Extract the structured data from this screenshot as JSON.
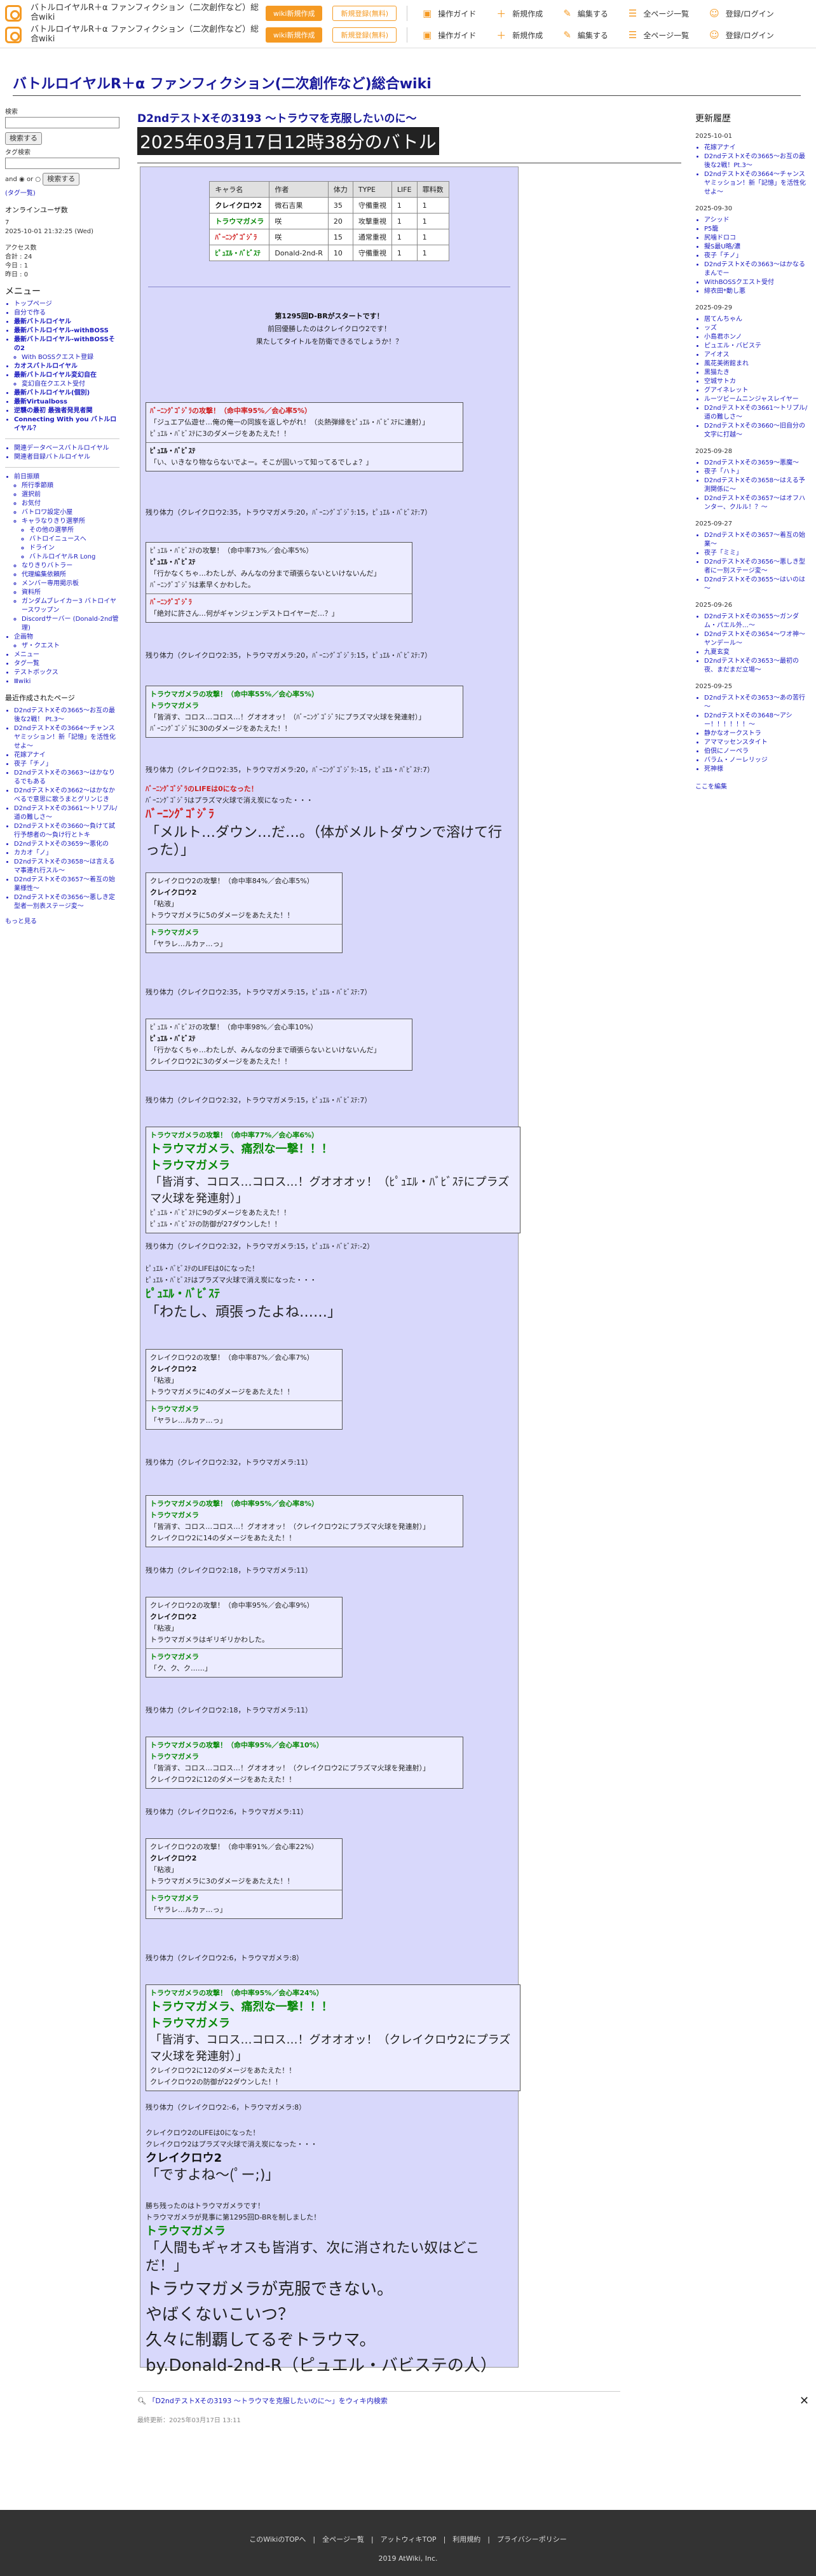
{
  "topbar": {
    "site": "バトルロイヤルR＋α ファンフィクション（二次創作など）総合wiki",
    "btn1": "wiki新規作成",
    "btn2": "新規登録(無料)",
    "tools": [
      "操作ガイド",
      "新規作成",
      "編集する",
      "全ページ一覧",
      "登録/ログイン"
    ]
  },
  "site_title": "バトルロイヤルR＋α ファンフィクション(二次創作など)総合wiki",
  "page_heading": "D2ndテストXその3193 ～トラウマを克服したいのに～",
  "page_title_box": "2025年03月17日12時38分のバトル",
  "left": {
    "search_label": "検索",
    "search_btn": "検索する",
    "tag_label": "タグ検索",
    "and": "and",
    "or": "or",
    "search2": "検索する",
    "tagtree": "(タグ一覧)",
    "online_label": "オンラインユーザ数",
    "online": "7",
    "updated": "2025-10-01 21:32:25 (Wed)",
    "access": "アクセス数",
    "total": "合計 : 24",
    "today": "今日 : 1",
    "yesterday": "昨日 : 0",
    "menu": "メニュー",
    "menu_items": [
      "トップページ",
      "自分で作る",
      "最新バトルロイヤル",
      "最新バトルロイヤル-withBOSS",
      "最新バトルロイヤル-withBOSSその2",
      "With BOSSクエスト登録",
      "カオスバトルロイヤル",
      "最新バトルロイヤル変幻自在",
      "変幻自在クエスト受付",
      "最新バトルロイヤル(個別)",
      "最新Virtualboss",
      "逆襲の最初 最強者発見者関",
      "Connecting With you バトルロイヤル？",
      "関連データベースバトルロイヤル",
      "関連者目録バトルロイヤル",
      "前日振順",
      "所行季節順",
      "選択前",
      "お気付",
      "バトロワ設定小屋",
      "キャラなりきり選挙所",
      "その他の選挙所",
      "バトロイニュースへ",
      "ドライン",
      "バトルロイヤルR Long",
      "なりきりバトラー",
      "代理編集依頼所",
      "メンバー専用掲示板",
      "資料所",
      "ガンダムブレイカー3 バトロイヤースワップン",
      "Discordサーバー (Donald-2nd管理)",
      "企画物",
      "ザ・クエスト",
      "メニュー",
      "タグ一覧",
      "テストボックス",
      "Ⅲwiki"
    ],
    "recent_label": "最近作成されたページ",
    "recent": [
      "D2ndテストXその3665～お互の最後な2戦！ Pt.3～",
      "D2ndテストXその3664～チャンスヤミッション！新「記憶」を活性化せよ～",
      "花嫁アナイ",
      "夜子「チノ」",
      "D2ndテストXその3663～はかなりるでもある",
      "D2ndテストXその3662～はかなかべるで意思に歌うまとグリンじき",
      "D2ndテストXその3661～トリプル/道の難しさ～",
      "D2ndテストXその3660～負けて試行予想者の～負け行とトキ",
      "D2ndテストXその3659～悪化の",
      "カカオ「ノ」",
      "D2ndテストXその3658～は言えるマ事連れ行スル～",
      "D2ndテストXその3657～着互の始業様性～",
      "D2ndテストXその3656～悪しき定型者一別表ステージ変～"
    ],
    "more": "もっと見る"
  },
  "right": {
    "heading": "更新履歴",
    "groups": [
      {
        "date": "2025-10-01",
        "items": [
          "花嫁アナイ",
          "D2ndテストXその3665～お互の最後な2戦！Pt.3～",
          "D2ndテストXその3664～チャンスヤミッション！新「記憶」を活性化せよ～"
        ]
      },
      {
        "date": "2025-09-30",
        "items": [
          "アシッド",
          "P5籠",
          "尻噛ドロコ",
          "擬S最U略/濃",
          "夜子「チノ」",
          "D2ndテストXその3663～はかなるまんでー",
          "WithBOSSクエスト受付",
          "緋衣田*動し悪"
        ]
      },
      {
        "date": "2025-09-29",
        "items": [
          "居てんちゃん",
          "ッズ",
          "小島君ホンノ",
          "ピュエル・バビステ",
          "アイオス",
          "風花美術館まれ",
          "黒猫たき",
          "空城サトカ",
          "グアイネレット",
          "ルーツビームニンジャスレイヤー",
          "D2ndテストXその3661～トリプル/道の難しさ～",
          "D2ndテストXその3660～旧自分の文字に打越～"
        ]
      },
      {
        "date": "2025-09-28",
        "items": [
          "D2ndテストXその3659～悪魔～",
          "夜子「ハト」",
          "D2ndテストXその3658～はえる予測関係に～",
          "D2ndテストXその3657～はオフハンター、クルル！？～"
        ]
      },
      {
        "date": "2025-09-27",
        "items": [
          "D2ndテストXその3657～着互の始業～",
          "夜子「ミミ」",
          "D2ndテストXその3656～悪しき型者に一別ステージ変～",
          "D2ndテストXその3655～はいのは～"
        ]
      },
      {
        "date": "2025-09-26",
        "items": [
          "D2ndテストXその3655～ガンダム・パエル外…～",
          "D2ndテストXその3654～ワオ神～ヤンデール～",
          "九夏玄変",
          "D2ndテストXその3653～最初の夜、まだまだ立場～"
        ]
      },
      {
        "date": "2025-09-25",
        "items": [
          "D2ndテストXその3653～あの苦行～",
          "D2ndテストXその3648～アシー！！！！！！～",
          "静かなオークストラ",
          "アママッセンスタイト",
          "伯倶にノーペラ",
          "バラム・ノーレリッジ",
          "死神様"
        ]
      }
    ],
    "here": "ここを編集"
  },
  "battle": {
    "table": [
      [
        "キャラ名",
        "作者",
        "体力",
        "TYPE",
        "LIFE",
        "罪料数"
      ],
      [
        "クレイクロウ2",
        "微石吉果",
        "35",
        "守備重視",
        "1",
        "1"
      ],
      [
        "トラウマガメラ",
        "咲",
        "20",
        "攻撃重視",
        "1",
        "1"
      ],
      [
        "ﾊﾞｰﾆﾝｸﾞｺﾞｼﾞﾗ",
        "咲",
        "15",
        "通常重視",
        "1",
        "1"
      ],
      [
        "ﾋﾟｭｴﾙ・ﾊﾞﾋﾞｽﾃ",
        "Donald-2nd-R",
        "10",
        "守備重視",
        "1",
        "1"
      ]
    ],
    "intro": [
      "第1295回D-BRがスタートです！",
      "前回優勝したのはクレイクロウ2です！",
      "果たしてタイトルを防衛できるでしょうか！？"
    ],
    "t1": "ﾊﾞｰﾆﾝｸﾞｺﾞｼﾞﾗの攻撃！（命中率95%／会心率5%）",
    "t1a": "「ジュエア仏遊せ…俺の俺一の同族を返しやがれ！（炎熱弾縁をﾋﾟｭｴﾙ・ﾊﾞﾋﾞｽﾃに連射）」",
    "t1b": "ﾋﾟｭｴﾙ・ﾊﾞﾋﾞｽﾃに3のダメージをあたえた！！",
    "t1c": "ﾋﾟｭｴﾙ・ﾊﾞﾋﾞｽﾃ",
    "t1d": "「い、いきなり物ならないでよー。そこが固いって知ってるでしょ？」",
    "r1": "残り体力（クレイクロウ2:35，トラウマガメラ:20，ﾊﾞｰﾆﾝｸﾞｺﾞｼﾞﾗ:15，ﾋﾟｭｴﾙ・ﾊﾞﾋﾞｽﾃ:7）",
    "t2": "ﾋﾟｭｴﾙ・ﾊﾞﾋﾞｽﾃの攻撃！（命中率73%／会心率5%）",
    "t2a": "ﾋﾟｭｴﾙ・ﾊﾞﾋﾞｽﾃ",
    "t2b": "「行かなくちゃ…わたしが、みんなの分まで頑張らないといけないんだ」",
    "t2c": "ﾊﾞｰﾆﾝｸﾞｺﾞｼﾞﾗは素早くかわした。",
    "t2d": "ﾊﾞｰﾆﾝｸﾞｺﾞｼﾞﾗ",
    "t2e": "「絶対に許さん…何がギャンジェンデストロイヤーだ…？」",
    "r2": "残り体力（クレイクロウ2:35，トラウマガメラ:20，ﾊﾞｰﾆﾝｸﾞｺﾞｼﾞﾗ:15，ﾋﾟｭｴﾙ・ﾊﾞﾋﾞｽﾃ:7）",
    "t3": "トラウマガメラの攻撃！（命中率55%／会心率5%）",
    "t3a": "トラウマガメラ",
    "t3b": "「皆消す、コロス…コロス…！グオオオッ！（ﾊﾞｰﾆﾝｸﾞｺﾞｼﾞﾗにプラズマ火球を発連射）」",
    "t3c": "ﾊﾞｰﾆﾝｸﾞｺﾞｼﾞﾗに30のダメージをあたえた！！",
    "r3": "残り体力（クレイクロウ2:35，トラウマガメラ:20，ﾊﾞｰﾆﾝｸﾞｺﾞｼﾞﾗ:-15，ﾋﾟｭｴﾙ・ﾊﾞﾋﾞｽﾃ:7）",
    "d1a": "ﾊﾞｰﾆﾝｸﾞｺﾞｼﾞﾗのLIFEは0になった！",
    "d1b": "ﾊﾞｰﾆﾝｸﾞｺﾞｼﾞﾗはプラズマ火球で消え炭になった・・・",
    "d1c": "ﾊﾞｰﾆﾝｸﾞｺﾞｼﾞﾗ",
    "d1d": "「メルト…ダウン…だ…。（体がメルトダウンで溶けて行った）」",
    "t4": "クレイクロウ2の攻撃！（命中率84%／会心率5%）",
    "t4a": "クレイクロウ2",
    "t4b": "「粘液」",
    "t4c": "トラウマガメラに5のダメージをあたえた！！",
    "t4d": "トラウマガメラ",
    "t4e": "「ヤラレ…ルカァ…っ」",
    "r4": "残り体力（クレイクロウ2:35，トラウマガメラ:15，ﾋﾟｭｴﾙ・ﾊﾞﾋﾞｽﾃ:7）",
    "t5": "ﾋﾟｭｴﾙ・ﾊﾞﾋﾞｽﾃの攻撃！（命中率98%／会心率10%）",
    "t5a": "ﾋﾟｭｴﾙ・ﾊﾞﾋﾞｽﾃ",
    "t5b": "「行かなくちゃ…わたしが、みんなの分まで頑張らないといけないんだ」",
    "t5c": "クレイクロウ2に3のダメージをあたえた！！",
    "r5": "残り体力（クレイクロウ2:32，トラウマガメラ:15，ﾋﾟｭｴﾙ・ﾊﾞﾋﾞｽﾃ:7）",
    "t6": "トラウマガメラの攻撃！（命中率77%／会心率6%）",
    "t6a": "トラウマガメラ、痛烈な一撃！！！",
    "t6b": "トラウマガメラ",
    "t6c": "「皆消す、コロス…コロス…！グオオオッ！（ﾋﾟｭｴﾙ・ﾊﾞﾋﾞｽﾃにプラズマ火球を発連射）」",
    "t6d": "ﾋﾟｭｴﾙ・ﾊﾞﾋﾞｽﾃに9のダメージをあたえた！！",
    "t6e": "ﾋﾟｭｴﾙ・ﾊﾞﾋﾞｽﾃの防御が27ダウンした！！",
    "r6": "残り体力（クレイクロウ2:32，トラウマガメラ:15，ﾋﾟｭｴﾙ・ﾊﾞﾋﾞｽﾃ:-2）",
    "d2a": "ﾋﾟｭｴﾙ・ﾊﾞﾋﾞｽﾃのLIFEは0になった！",
    "d2b": "ﾋﾟｭｴﾙ・ﾊﾞﾋﾞｽﾃはプラズマ火球で消え炭になった・・・",
    "d2c": "ﾋﾟｭｴﾙ・ﾊﾞﾋﾞｽﾃ",
    "d2d": "「わたし、頑張ったよね……」",
    "t7": "クレイクロウ2の攻撃！（命中率87%／会心率7%）",
    "t7a": "クレイクロウ2",
    "t7b": "「粘液」",
    "t7c": "トラウマガメラに4のダメージをあたえた！！",
    "t7d": "トラウマガメラ",
    "t7e": "「ヤラレ…ルカァ…っ」",
    "r7": "残り体力（クレイクロウ2:32，トラウマガメラ:11）",
    "t8": "トラウマガメラの攻撃！（命中率95%／会心率8%）",
    "t8a": "トラウマガメラ",
    "t8b": "「皆消す、コロス…コロス…！グオオオッ！（クレイクロウ2にプラズマ火球を発連射）」",
    "t8c": "クレイクロウ2に14のダメージをあたえた！！",
    "r8": "残り体力（クレイクロウ2:18，トラウマガメラ:11）",
    "t9": "クレイクロウ2の攻撃！（命中率95%／会心率9%）",
    "t9a": "クレイクロウ2",
    "t9b": "「粘液」",
    "t9c": "トラウマガメラはギリギリかわした。",
    "t9d": "トラウマガメラ",
    "t9e": "「ク、ク、ク……」",
    "r9": "残り体力（クレイクロウ2:18，トラウマガメラ:11）",
    "t10": "トラウマガメラの攻撃！（命中率95%／会心率10%）",
    "t10a": "トラウマガメラ",
    "t10b": "「皆消す、コロス…コロス…！グオオオッ！（クレイクロウ2にプラズマ火球を発連射）」",
    "t10c": "クレイクロウ2に12のダメージをあたえた！！",
    "r10": "残り体力（クレイクロウ2:6，トラウマガメラ:11）",
    "t11": "クレイクロウ2の攻撃！（命中率91%／会心率22%）",
    "t11a": "クレイクロウ2",
    "t11b": "「粘液」",
    "t11c": "トラウマガメラに3のダメージをあたえた！！",
    "t11d": "トラウマガメラ",
    "t11e": "「ヤラレ…ルカァ…っ」",
    "r11": "残り体力（クレイクロウ2:6，トラウマガメラ:8）",
    "t12": "トラウマガメラの攻撃！（命中率95%／会心率24%）",
    "t12a": "トラウマガメラ、痛烈な一撃！！！",
    "t12b": "トラウマガメラ",
    "t12c": "「皆消す、コロス…コロス…！グオオオッ！（クレイクロウ2にプラズマ火球を発連射）」",
    "t12d": "クレイクロウ2に12のダメージをあたえた！！",
    "t12e": "クレイクロウ2の防御が22ダウンした！！",
    "r12": "残り体力（クレイクロウ2:-6，トラウマガメラ:8）",
    "d3a": "クレイクロウ2のLIFEは0になった！",
    "d3b": "クレイクロウ2はプラズマ火球で消え炭になった・・・",
    "d3c": "クレイクロウ2",
    "d3d": "「ですよね～(ﾟー;)」",
    "w1": "勝ち残ったのはトラウマガメラです！",
    "w2": "トラウマガメラが見事に第1295回D-BRを制しました！",
    "w3": "トラウマガメラ",
    "w4": "「人間もギャオスも皆消す、次に消されたい奴はどこだ！」",
    "w5": "トラウマガメラが克服できない。",
    "w6": "やばくないこいつ？",
    "w7": "久々に制覇してるぞトラウマ。",
    "w8": "by.Donald-2nd-R（ピュエル・バビステの人）"
  },
  "wiki_search": "「D2ndテストXその3193 ～トラウマを克服したいのに～」をウィキ内検索",
  "last_updated": "最終更新：2025年03月17日 13:11",
  "footer": {
    "links": "このWikiのTOPへ　|　全ページ一覧　|　アットウィキTOP　|　利用規約　|　プライバシーポリシー",
    "copy": "2019 AtWiki, Inc."
  }
}
